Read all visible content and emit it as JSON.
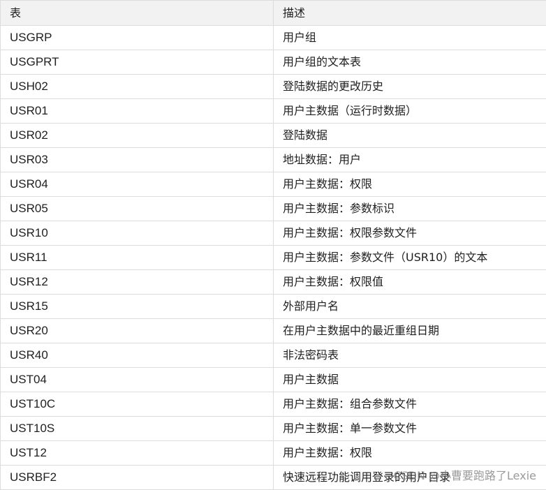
{
  "table": {
    "headers": [
      "表",
      "描述"
    ],
    "rows": [
      [
        "USGRP",
        "用户组"
      ],
      [
        "USGPRT",
        "用户组的文本表"
      ],
      [
        "USH02",
        "登陆数据的更改历史"
      ],
      [
        "USR01",
        "用户主数据（运行时数据）"
      ],
      [
        "USR02",
        "登陆数据"
      ],
      [
        "USR03",
        "地址数据：用户"
      ],
      [
        "USR04",
        "用户主数据：权限"
      ],
      [
        "USR05",
        "用户主数据：参数标识"
      ],
      [
        "USR10",
        "用户主数据：权限参数文件"
      ],
      [
        "USR11",
        "用户主数据：参数文件（USR10）的文本"
      ],
      [
        "USR12",
        "用户主数据：权限值"
      ],
      [
        "USR15",
        "外部用户名"
      ],
      [
        "USR20",
        "在用户主数据中的最近重组日期"
      ],
      [
        "USR40",
        "非法密码表"
      ],
      [
        "UST04",
        "用户主数据"
      ],
      [
        "UST10C",
        "用户主数据：组合参数文件"
      ],
      [
        "UST10S",
        "用户主数据：单一参数文件"
      ],
      [
        "UST12",
        "用户主数据：权限"
      ],
      [
        "USRBF2",
        "快速远程功能调用登录的用户目录"
      ]
    ]
  },
  "watermark": "CSDN @小曹要跑路了Lexie"
}
